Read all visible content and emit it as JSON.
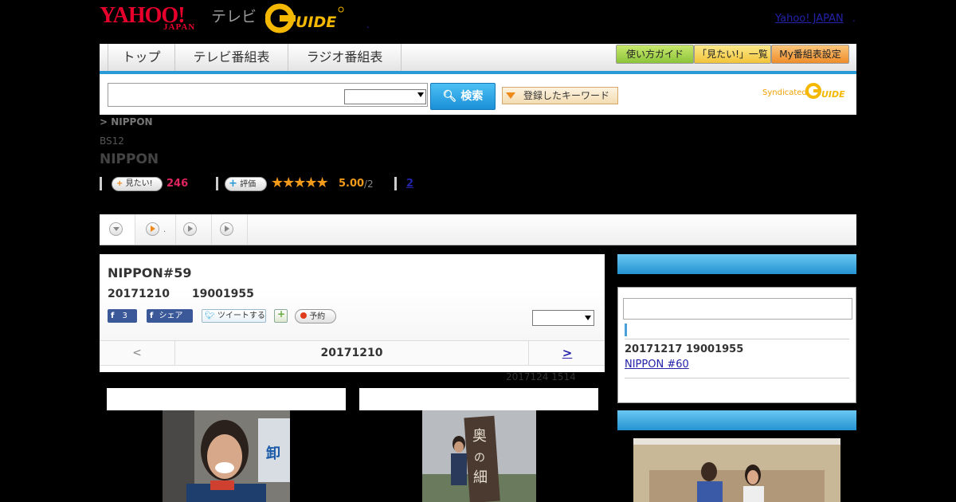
{
  "header": {
    "logo_yahoo": "YAHOO!",
    "logo_japan": "JAPAN",
    "logo_tv": "テレビ",
    "logo_gguide": "G-GUIDE",
    "dot1": ".",
    "yahoo_link": "Yahoo! JAPAN",
    "dot2": "."
  },
  "nav": {
    "tabs": [
      "トップ",
      "テレビ番組表",
      "ラジオ番組表"
    ],
    "guide_buttons": [
      "使い方ガイド",
      "「見たい!」一覧",
      "My番組表設定"
    ]
  },
  "search": {
    "input_value": "",
    "select_value": "",
    "button_label": "検索",
    "keyword_button": "登録したキーワード",
    "syndicated": "Syndicated"
  },
  "program": {
    "breadcrumb": "> NIPPON",
    "channel": "BS12",
    "title": "NIPPON",
    "mitai_label": "見たい!",
    "mitai_count": "246",
    "hyouka_label": "評価",
    "rating_stars": 5,
    "rating_value": "5.00",
    "rating_count": "/2",
    "review_link": "2"
  },
  "tabs": {
    "dot": "."
  },
  "episode": {
    "title": "NIPPON#59",
    "date": "20171210　　19001955",
    "like_count": "3",
    "share_label": "シェア",
    "tweet_label": "ツイートする",
    "reserve_label": "予約",
    "select_value": "",
    "prev": "<",
    "current_date": "20171210",
    "next": ">",
    "updated": "2017124  1514"
  },
  "sidebar": {
    "next_date": "20171217  19001955",
    "next_link": "NIPPON #60"
  },
  "colors": {
    "accent_blue": "#2a9ad6",
    "mitai_pink": "#e0245e",
    "rating_orange": "#f29a1a"
  }
}
